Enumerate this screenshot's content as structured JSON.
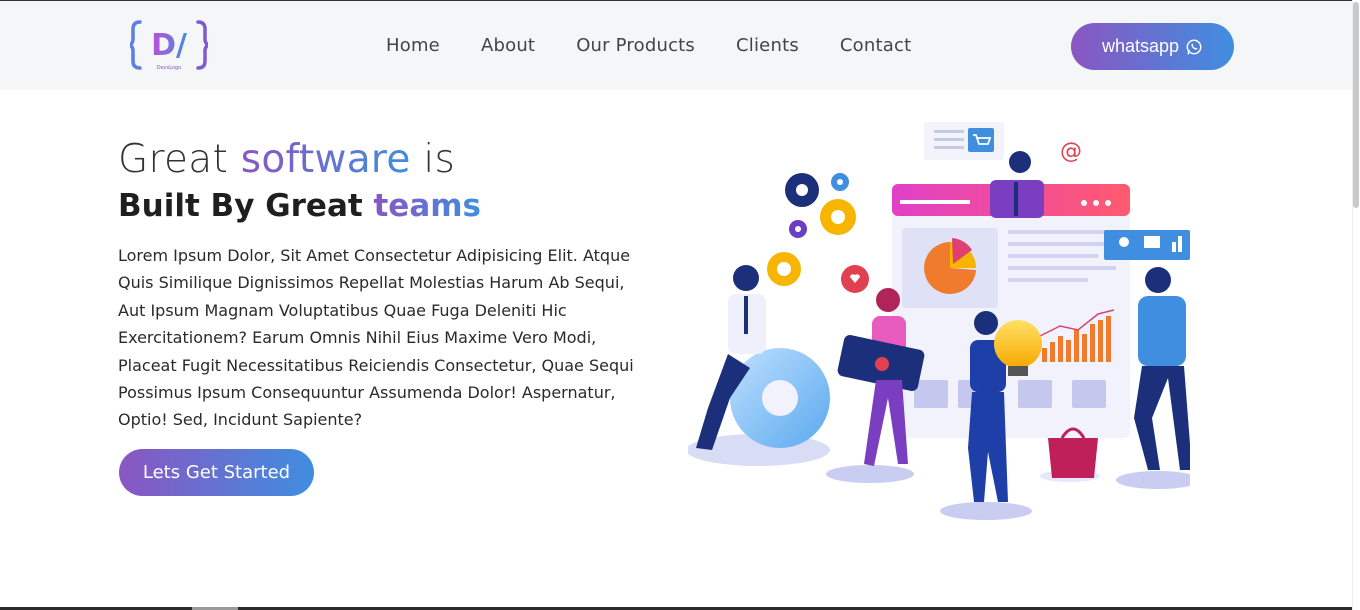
{
  "navbar": {
    "logo_text": "D/",
    "logo_caption": "DevsLogo",
    "links": [
      {
        "label": "Home"
      },
      {
        "label": "About"
      },
      {
        "label": "Our Products"
      },
      {
        "label": "Clients"
      },
      {
        "label": "Contact"
      }
    ],
    "whatsapp_label": "whatsapp",
    "whatsapp_icon": "whatsapp-icon"
  },
  "hero": {
    "title_part1": "Great ",
    "title_highlight": "software",
    "title_part2": " is",
    "subtitle_part1": "Built By Great ",
    "subtitle_highlight": "teams",
    "body": "Lorem Ipsum Dolor, Sit Amet Consectetur Adipisicing Elit. Atque Quis Similique Dignissimos Repellat Molestias Harum Ab Sequi, Aut Ipsum Magnam Voluptatibus Quae Fuga Deleniti Hic Exercitationem? Earum Omnis Nihil Eius Maxime Vero Modi, Placeat Fugit Necessitatibus Reiciendis Consectetur, Quae Sequi Possimus Ipsum Consequuntur Assumenda Dolor! Aspernatur, Optio! Sed, Incidunt Sapiente?",
    "cta_label": "Lets Get Started"
  },
  "colors": {
    "gradient_start": "#8a56c2",
    "gradient_end": "#3f8ee0",
    "navbar_bg": "#f5f6f8"
  }
}
